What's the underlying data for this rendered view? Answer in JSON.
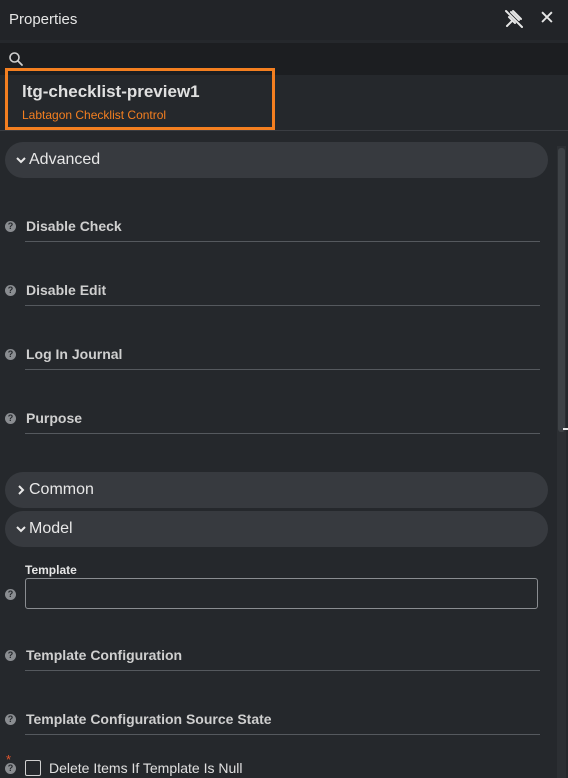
{
  "panel": {
    "title": "Properties"
  },
  "search": {
    "value": "",
    "placeholder": ""
  },
  "component": {
    "name": "ltg-checklist-preview1",
    "type": "Labtagon Checklist Control"
  },
  "sections": {
    "advanced": {
      "label": "Advanced",
      "expanded": true
    },
    "common": {
      "label": "Common",
      "expanded": false
    },
    "model": {
      "label": "Model",
      "expanded": true
    }
  },
  "advanced_props": [
    {
      "label": "Disable Check"
    },
    {
      "label": "Disable Edit"
    },
    {
      "label": "Log In Journal"
    },
    {
      "label": "Purpose"
    }
  ],
  "model_props": {
    "template": {
      "label": "Template",
      "value": ""
    },
    "template_configuration": {
      "label": "Template Configuration"
    },
    "template_configuration_source_state": {
      "label": "Template Configuration Source State"
    },
    "delete_items": {
      "label": "Delete Items If Template Is Null",
      "checked": false,
      "required_mark": "*"
    }
  },
  "help_glyph": "?",
  "icons": {
    "pin": "unpin-icon",
    "close": "close-icon",
    "search": "search-icon",
    "expanded": "chevron-down-icon",
    "collapsed": "chevron-right-icon",
    "help": "help-icon"
  },
  "colors": {
    "accent": "#f47f20",
    "background": "#25282c",
    "section": "#373a3f",
    "required": "#e4572e"
  }
}
